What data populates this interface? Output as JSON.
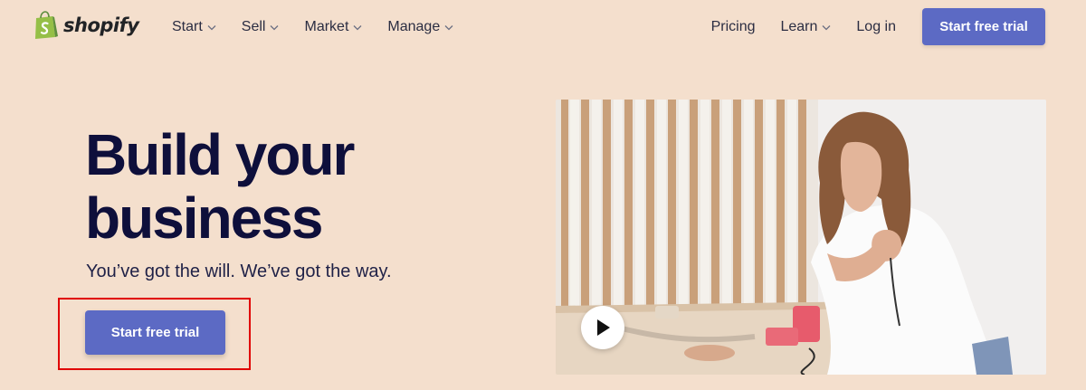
{
  "brand": {
    "name": "shopify",
    "accent": "#5c6ac4",
    "logo_green": "#95bf47"
  },
  "nav": {
    "left": [
      {
        "label": "Start",
        "has_dropdown": true
      },
      {
        "label": "Sell",
        "has_dropdown": true
      },
      {
        "label": "Market",
        "has_dropdown": true
      },
      {
        "label": "Manage",
        "has_dropdown": true
      }
    ],
    "right": {
      "pricing": "Pricing",
      "learn": "Learn",
      "login": "Log in",
      "cta": "Start free trial"
    }
  },
  "hero": {
    "title_line1": "Build your",
    "title_line2": "business",
    "subtitle": "You’ve got the will. We’ve got the way.",
    "cta": "Start free trial"
  },
  "video": {
    "icon": "play-icon"
  }
}
